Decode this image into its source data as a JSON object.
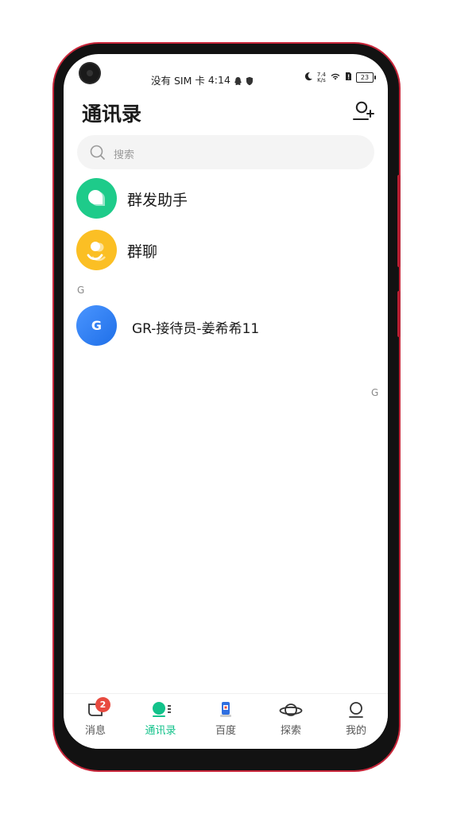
{
  "status_bar": {
    "carrier": "没有 SIM 卡",
    "time": "4:14",
    "net_speed_value": "7.4",
    "net_speed_unit": "K/s",
    "battery": "23"
  },
  "header": {
    "title": "通讯录",
    "add_contact_icon": "person-add-icon"
  },
  "search": {
    "placeholder": "搜索"
  },
  "special_items": [
    {
      "label": "群发助手",
      "color": "#1ecb8a"
    },
    {
      "label": "群聊",
      "color": "#fbbf24"
    }
  ],
  "sections": [
    {
      "letter": "G",
      "contacts": [
        {
          "initial": "G",
          "name": "GR-接待员-姜希希11",
          "color": "#2f7ff0"
        }
      ]
    }
  ],
  "index_bar": [
    "G"
  ],
  "tabs": [
    {
      "label": "消息",
      "icon": "message-bubble-icon",
      "badge": "2"
    },
    {
      "label": "通讯录",
      "icon": "contacts-icon",
      "active": true
    },
    {
      "label": "百度",
      "icon": "baidu-app-icon"
    },
    {
      "label": "探索",
      "icon": "planet-icon"
    },
    {
      "label": "我的",
      "icon": "profile-icon"
    }
  ],
  "colors": {
    "accent": "#12c28a",
    "badge": "#e84a3f"
  }
}
